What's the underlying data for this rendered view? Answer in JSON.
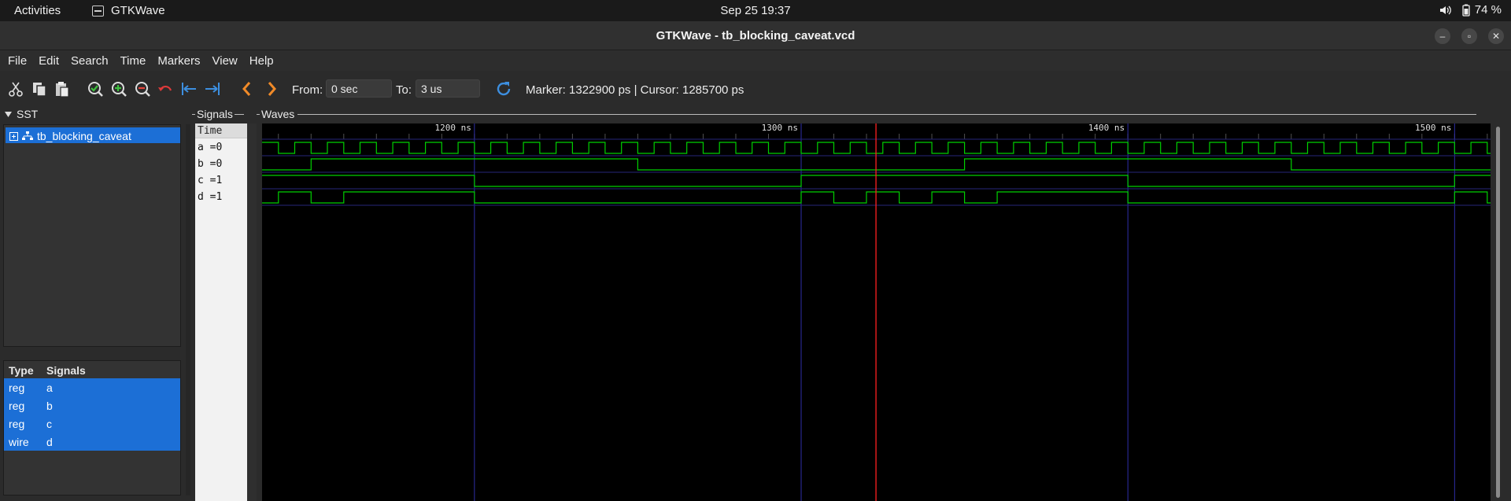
{
  "system_bar": {
    "activities": "Activities",
    "app_name": "GTKWave",
    "clock": "Sep 25  19:37",
    "battery": "74 %",
    "icons": [
      "speaker-icon",
      "battery-icon"
    ]
  },
  "window": {
    "title": "GTKWave - tb_blocking_caveat.vcd",
    "controls": [
      "–",
      "▫",
      "✕"
    ]
  },
  "menu": [
    "File",
    "Edit",
    "Search",
    "Time",
    "Markers",
    "View",
    "Help"
  ],
  "toolbar": {
    "from_label": "From:",
    "from_value": "0 sec",
    "to_label": "To:",
    "to_value": "3 us",
    "status": "Marker: 1322900 ps  |  Cursor: 1285700 ps",
    "icons": [
      "cut-icon",
      "copy-icon",
      "paste-icon",
      "zoom-fit-icon",
      "zoom-in-icon",
      "zoom-out-icon",
      "undo-icon",
      "jump-start-icon",
      "jump-end-icon",
      "prev-edge-icon",
      "next-edge-icon",
      "reload-icon"
    ]
  },
  "sst": {
    "title": "SST",
    "tree_item": "tb_blocking_caveat",
    "type_header": "Type",
    "signals_header": "Signals",
    "signals": [
      {
        "type": "reg",
        "name": "a"
      },
      {
        "type": "reg",
        "name": "b"
      },
      {
        "type": "reg",
        "name": "c"
      },
      {
        "type": "wire",
        "name": "d"
      }
    ]
  },
  "signals_pane": {
    "title": "Signals",
    "time_label": "Time",
    "rows": [
      "a =0",
      "b =0",
      "c =1",
      "d =1"
    ]
  },
  "waves_pane": {
    "title": "Waves",
    "time_labels": [
      "1200 ns",
      "1300 ns",
      "1400 ns",
      "1500 ns"
    ],
    "time_marks_ns": [
      1200,
      1300,
      1400,
      1500
    ],
    "view_start_ns": 1135,
    "view_end_ns": 1511,
    "cursor_ns": 1322.9,
    "wave_color": "#00d000",
    "cursor_color": "#ff2020",
    "grid_color": "#2e2ea8"
  },
  "signal_edges_ns": {
    "a": [
      1135,
      1140,
      1145,
      1150,
      1155,
      1160,
      1165,
      1170,
      1175,
      1180,
      1185,
      1190,
      1195,
      1200,
      1205,
      1210,
      1215,
      1220,
      1225,
      1230,
      1235,
      1240,
      1245,
      1250,
      1255,
      1260,
      1265,
      1270,
      1275,
      1280,
      1285,
      1290,
      1295,
      1300,
      1305,
      1310,
      1315,
      1320,
      1325,
      1330,
      1335,
      1340,
      1345,
      1350,
      1355,
      1360,
      1365,
      1370,
      1375,
      1380,
      1385,
      1390,
      1395,
      1400,
      1405,
      1410,
      1415,
      1420,
      1425,
      1430,
      1435,
      1440,
      1445,
      1450,
      1455,
      1460,
      1465,
      1470,
      1475,
      1480,
      1485,
      1490,
      1495,
      1500,
      1505,
      1510
    ],
    "b": [
      1150,
      1250,
      1350,
      1450
    ],
    "c": [
      1200,
      1300,
      1400,
      1500
    ],
    "d": [
      1140,
      1150,
      1160,
      1200,
      1300,
      1310,
      1320,
      1330,
      1340,
      1350,
      1360,
      1400,
      1500,
      1510
    ]
  },
  "signal_start_levels": {
    "a": 1,
    "b": 0,
    "c": 1,
    "d": 0
  }
}
